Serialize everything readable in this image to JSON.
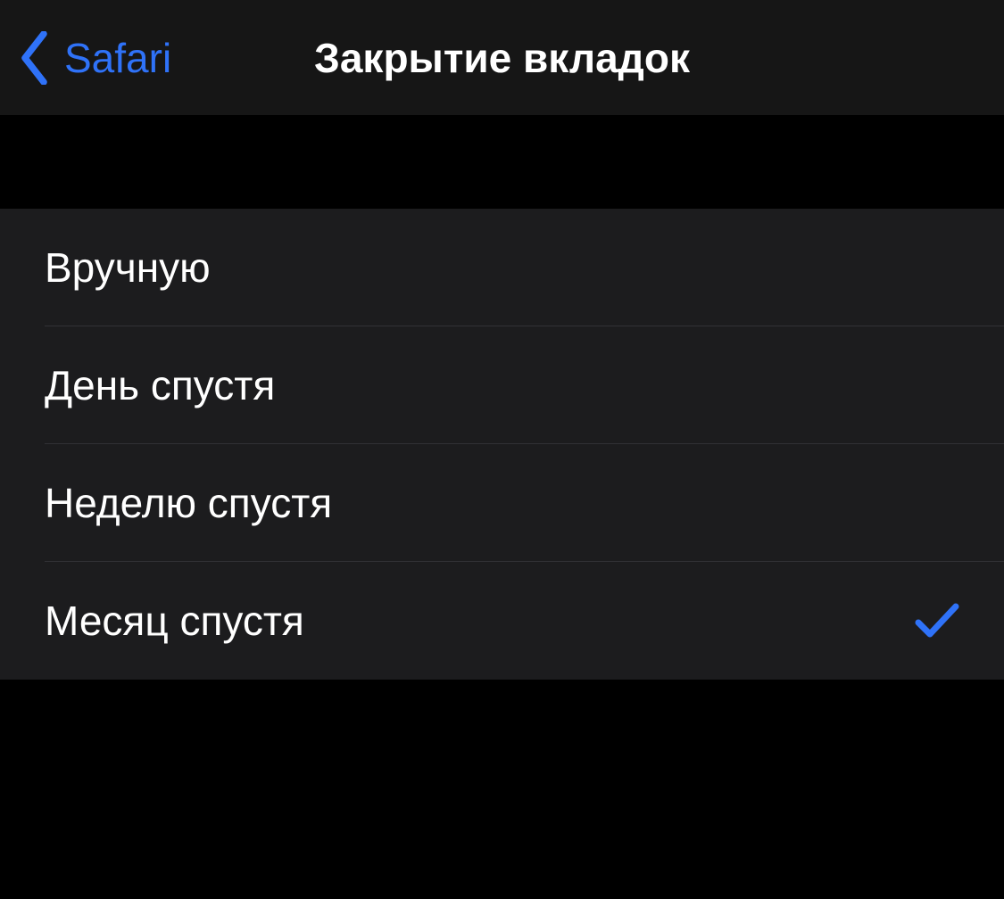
{
  "navbar": {
    "back_label": "Safari",
    "title": "Закрытие вкладок"
  },
  "options": [
    {
      "label": "Вручную",
      "selected": false
    },
    {
      "label": "День спустя",
      "selected": false
    },
    {
      "label": "Неделю спустя",
      "selected": false
    },
    {
      "label": "Месяц спустя",
      "selected": true
    }
  ],
  "colors": {
    "accent": "#2f72f8"
  }
}
